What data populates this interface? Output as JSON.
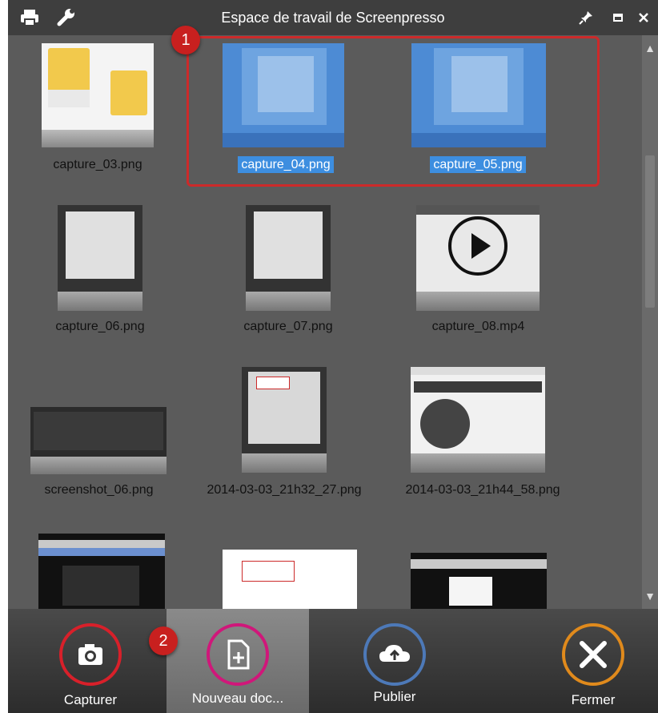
{
  "window": {
    "title": "Espace de travail de Screenpresso"
  },
  "thumbnails": [
    {
      "label": "capture_03.png",
      "selected": false
    },
    {
      "label": "capture_04.png",
      "selected": true
    },
    {
      "label": "capture_05.png",
      "selected": true
    },
    {
      "label": "capture_06.png",
      "selected": false
    },
    {
      "label": "capture_07.png",
      "selected": false
    },
    {
      "label": "capture_08.mp4",
      "selected": false
    },
    {
      "label": "screenshot_06.png",
      "selected": false
    },
    {
      "label": "2014-03-03_21h32_27.png",
      "selected": false
    },
    {
      "label": "2014-03-03_21h44_58.png",
      "selected": false
    }
  ],
  "badges": {
    "one": "1",
    "two": "2"
  },
  "toolbar": {
    "capture": "Capturer",
    "new_doc": "Nouveau doc...",
    "publish": "Publier",
    "close": "Fermer"
  },
  "colors": {
    "selection": "#3d8ee0",
    "annotation": "#cc2a2a",
    "capture_ring": "#d8202a",
    "newdoc_ring": "#d0177a",
    "publish_ring": "#4d79b8",
    "close_ring": "#e08a1c"
  }
}
